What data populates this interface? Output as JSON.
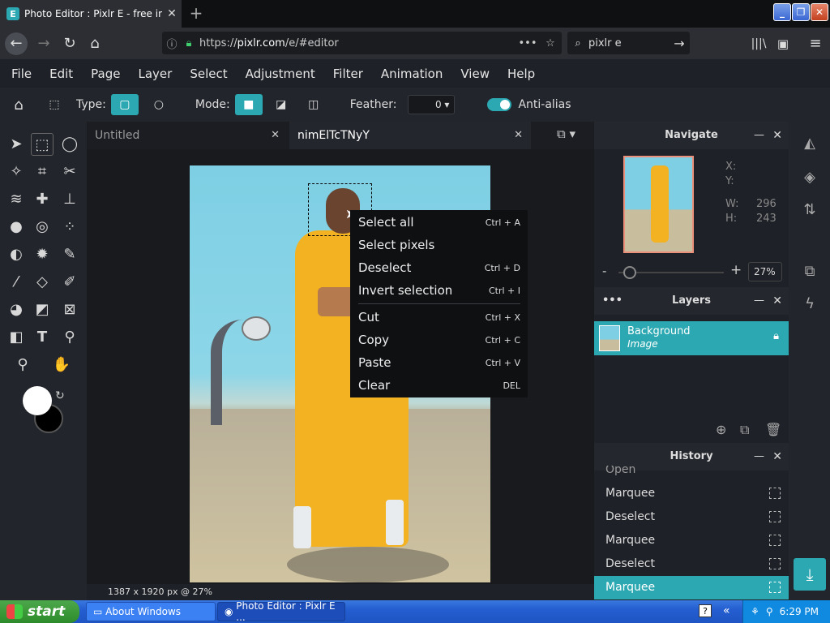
{
  "browser": {
    "tab_title": "Photo Editor : Pixlr E - free image",
    "tab_favicon": "E",
    "url_prefix": "https://",
    "url_host": "pixlr.com",
    "url_path": "/e/#editor",
    "search_text": "pixlr e"
  },
  "menu": [
    "File",
    "Edit",
    "Page",
    "Layer",
    "Select",
    "Adjustment",
    "Filter",
    "Animation",
    "View",
    "Help"
  ],
  "options": {
    "type_label": "Type:",
    "mode_label": "Mode:",
    "feather_label": "Feather:",
    "feather_value": "0",
    "antialias_label": "Anti-alias",
    "antialias_on": true
  },
  "doc_tabs": [
    {
      "label": "Untitled",
      "active": false
    },
    {
      "label": "nimElTcTNyY",
      "active": true
    }
  ],
  "status_text": "1387 x 1920 px @ 27%",
  "context_menu": [
    {
      "label": "Select all",
      "shortcut": "Ctrl + A"
    },
    {
      "label": "Select pixels",
      "shortcut": ""
    },
    {
      "label": "Deselect",
      "shortcut": "Ctrl + D"
    },
    {
      "label": "Invert selection",
      "shortcut": "Ctrl + I"
    },
    {
      "label": "Cut",
      "shortcut": "Ctrl + X"
    },
    {
      "label": "Copy",
      "shortcut": "Ctrl + C"
    },
    {
      "label": "Paste",
      "shortcut": "Ctrl + V"
    },
    {
      "label": "Clear",
      "shortcut": "DEL"
    }
  ],
  "navigate": {
    "title": "Navigate",
    "x_label": "X:",
    "y_label": "Y:",
    "w_label": "W:",
    "w_value": "296",
    "h_label": "H:",
    "h_value": "243",
    "zoom_minus": "-",
    "zoom_plus": "+",
    "zoom": "27%",
    "zoom_fraction": 0.05
  },
  "layers": {
    "title": "Layers",
    "items": [
      {
        "name": "Background",
        "subtitle": "Image",
        "locked": true
      }
    ]
  },
  "history": {
    "title": "History",
    "partial_top": "Open",
    "items": [
      {
        "label": "Marquee",
        "active": false
      },
      {
        "label": "Deselect",
        "active": false
      },
      {
        "label": "Marquee",
        "active": false
      },
      {
        "label": "Deselect",
        "active": false
      },
      {
        "label": "Marquee",
        "active": true
      }
    ]
  },
  "taskbar": {
    "start_label": "start",
    "items": [
      "About Windows",
      "Photo Editor : Pixlr E ..."
    ],
    "clock": "6:29 PM"
  },
  "colors": {
    "accent": "#2ba8b1",
    "panel": "#1e2127",
    "toolbar": "#22252b"
  }
}
